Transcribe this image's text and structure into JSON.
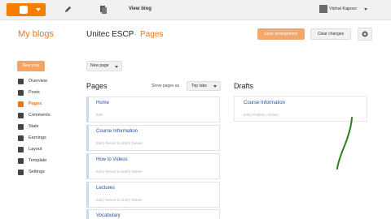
{
  "topbar": {
    "view_blog": "View blog",
    "user_name": "Vishal Kapoor",
    "logo_icon": "blogger-logo-icon",
    "pencil_icon": "pencil-icon",
    "pages_icon": "copy-pages-icon",
    "brand_color": "#f57d00"
  },
  "header": {
    "my_blogs": "My blogs",
    "blog_name": "Unitec ESCP",
    "separator": "·",
    "current_page": "Pages",
    "save_button": "Save arrangement",
    "clear_button": "Clear changes",
    "gear_icon": "gear-icon"
  },
  "sidebar": {
    "new_post": "New post",
    "items": [
      {
        "label": "Overview",
        "icon": "overview-icon",
        "active": false
      },
      {
        "label": "Posts",
        "icon": "posts-icon",
        "active": false
      },
      {
        "label": "Pages",
        "icon": "pages-icon",
        "active": true
      },
      {
        "label": "Comments",
        "icon": "comments-icon",
        "active": false
      },
      {
        "label": "Stats",
        "icon": "stats-icon",
        "active": false
      },
      {
        "label": "Earnings",
        "icon": "earnings-icon",
        "active": false
      },
      {
        "label": "Layout",
        "icon": "layout-icon",
        "active": false
      },
      {
        "label": "Template",
        "icon": "template-icon",
        "active": false
      },
      {
        "label": "Settings",
        "icon": "settings-icon",
        "active": false
      }
    ]
  },
  "main": {
    "new_page": "New page",
    "pages_title": "Pages",
    "show_pages_as": "Show pages as",
    "show_as_value": "Top tabs",
    "pages": [
      {
        "title": "Home",
        "actions": "Edit"
      },
      {
        "title": "Course Information",
        "actions": "Edit | Revert to draft | Delete"
      },
      {
        "title": "How to Videos",
        "actions": "Edit | Revert to draft | Delete"
      },
      {
        "title": "Lectures",
        "actions": "Edit | Revert to draft | Delete"
      },
      {
        "title": "Vocabulary",
        "actions": ""
      }
    ],
    "drafts_title": "Drafts",
    "drafts": [
      {
        "title": "Course Information",
        "actions": "Edit | Publish | Delete"
      }
    ]
  },
  "colors": {
    "accent": "#e8761e",
    "link": "#1f4e9a",
    "annotation_stroke": "#2e7d1f"
  }
}
